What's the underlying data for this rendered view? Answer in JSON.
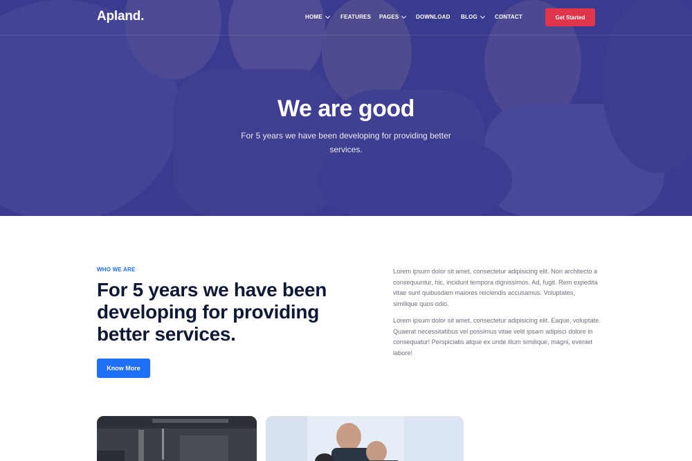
{
  "brand": {
    "logo": "Apland."
  },
  "nav": {
    "items": [
      {
        "label": "HOME",
        "dropdown": true
      },
      {
        "label": "FEATURES",
        "dropdown": false
      },
      {
        "label": "PAGES",
        "dropdown": true
      },
      {
        "label": "DOWNLOAD",
        "dropdown": false
      },
      {
        "label": "BLOG",
        "dropdown": true
      },
      {
        "label": "CONTACT",
        "dropdown": false
      }
    ],
    "cta": "Get Started"
  },
  "hero": {
    "title": "We are good",
    "subtitle": "For 5 years we have been developing for providing better services."
  },
  "about": {
    "eyebrow": "WHO WE ARE",
    "heading": "For 5 years we have been developing for providing better services.",
    "button": "Know More",
    "paragraphs": [
      "Lorem ipsum dolor sit amet, consectetur adipisicing elit. Non architecto a consequuntur, hic, incidunt tempora dignissimos. Ad, fugit. Rem expedita vitae sunt quibusdam maiores reiciendis accusamus. Voluptates, similique quos odio.",
      "Lorem ipsum dolor sit amet, consectetur adipisicing elit. Eaque, voluptate. Quaerat necessitatibus vel possimus vitae velit ipsam adipisci dolore in consequatur! Perspiciatis atque ex unde illum similique, magni, eveniet labore!"
    ]
  },
  "colors": {
    "hero_overlay": "#3a3b8f",
    "cta_red": "#e0354b",
    "accent_blue": "#1e6ef6",
    "heading_dark": "#0f1835",
    "body_gray": "#6b6f7d"
  }
}
